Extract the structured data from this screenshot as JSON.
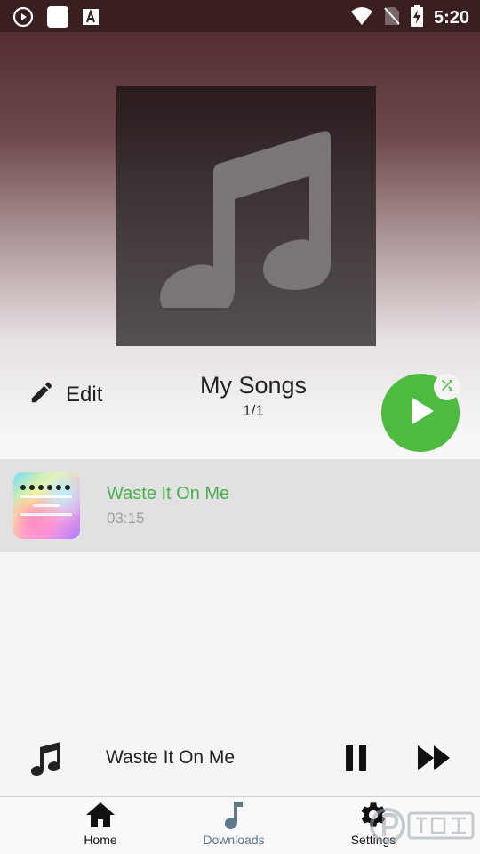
{
  "status_bar": {
    "time": "5:20",
    "icons": [
      "play-circle-icon",
      "app-square-icon",
      "font-a-icon",
      "wifi-icon",
      "no-sim-icon",
      "battery-charging-icon"
    ]
  },
  "header": {
    "edit_label": "Edit",
    "playlist_title": "My Songs",
    "playlist_count": "1/1",
    "album_icon": "music-note-icon",
    "play_icon": "play-icon",
    "shuffle_icon": "shuffle-icon"
  },
  "songs": [
    {
      "title": "Waste It On Me",
      "duration": "03:15"
    }
  ],
  "mini_player": {
    "title": "Waste It On Me",
    "icons": [
      "music-note-icon",
      "pause-icon",
      "fast-forward-icon"
    ]
  },
  "bottom_nav": {
    "items": [
      {
        "label": "Home",
        "icon": "home-icon"
      },
      {
        "label": "Downloads",
        "icon": "music-note-icon"
      },
      {
        "label": "Settings",
        "icon": "gear-icon"
      }
    ]
  },
  "colors": {
    "accent_green": "#4cbb3f",
    "song_title_green": "#4caf50",
    "status_bar": "#3a1f21"
  }
}
